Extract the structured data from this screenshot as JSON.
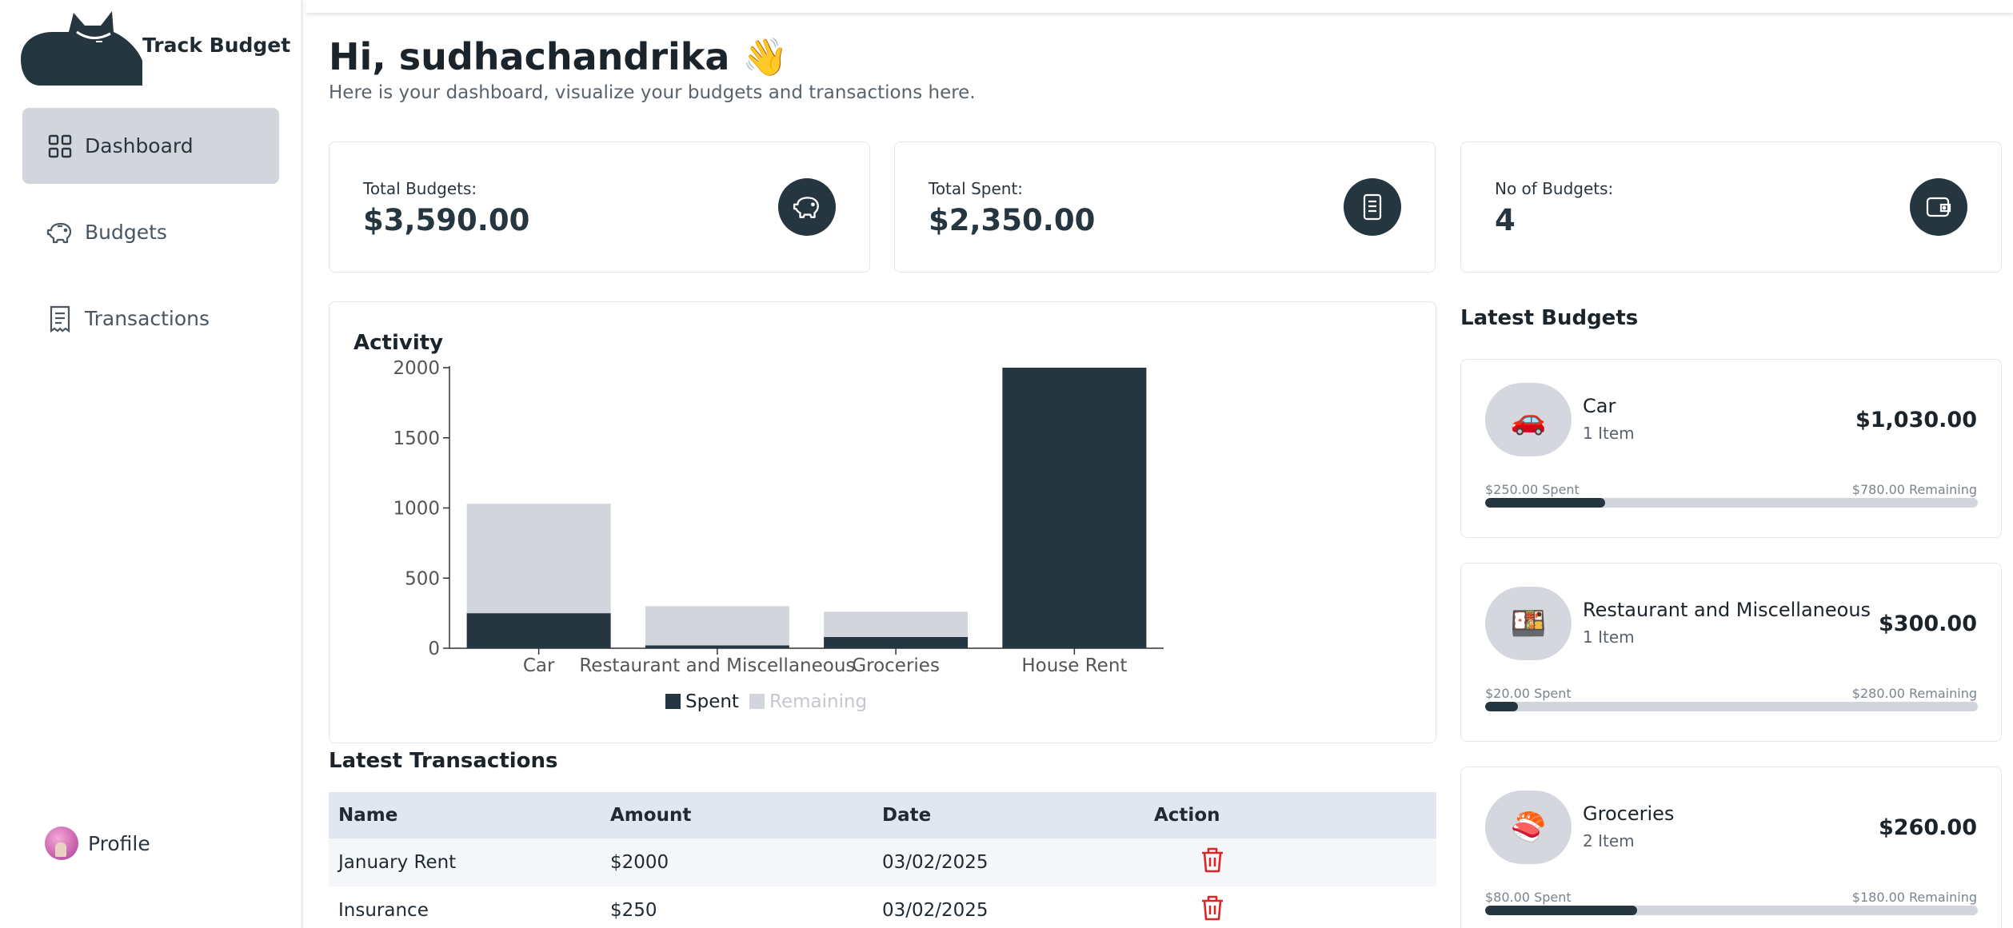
{
  "app": {
    "brand_name": "Track Budget"
  },
  "sidebar": {
    "items": [
      {
        "label": "Dashboard",
        "icon": "dashboard-grid-icon",
        "active": true
      },
      {
        "label": "Budgets",
        "icon": "piggy-bank-icon",
        "active": false
      },
      {
        "label": "Transactions",
        "icon": "receipt-icon",
        "active": false
      }
    ],
    "profile_label": "Profile"
  },
  "header": {
    "greeting": "Hi, sudhachandrika 👋",
    "subtitle": "Here is your dashboard, visualize your budgets and transactions here."
  },
  "stats": [
    {
      "label": "Total Budgets:",
      "value": "$3,590.00",
      "icon": "piggy-bank-icon"
    },
    {
      "label": "Total Spent:",
      "value": "$2,350.00",
      "icon": "receipt-icon"
    },
    {
      "label": "No of Budgets:",
      "value": "4",
      "icon": "wallet-icon"
    }
  ],
  "activity": {
    "title": "Activity"
  },
  "chart_data": {
    "type": "bar",
    "stacked": true,
    "title": "Activity",
    "categories": [
      "Car",
      "Restaurant and Miscellaneous",
      "Groceries",
      "House Rent"
    ],
    "series": [
      {
        "name": "Spent",
        "values": [
          250,
          20,
          80,
          2000
        ],
        "color": "#263640"
      },
      {
        "name": "Remaining",
        "values": [
          780,
          280,
          180,
          0
        ],
        "color": "#d2d5db"
      }
    ],
    "yticks": [
      0,
      500,
      1000,
      1500,
      2000
    ],
    "ylim": [
      0,
      2000
    ],
    "legend": "bottom",
    "grid": false
  },
  "transactions": {
    "title": "Latest Transactions",
    "columns": [
      "Name",
      "Amount",
      "Date",
      "Action"
    ],
    "rows": [
      {
        "name": "January Rent",
        "amount": "$2000",
        "date": "03/02/2025"
      },
      {
        "name": "Insurance",
        "amount": "$250",
        "date": "03/02/2025"
      }
    ]
  },
  "latest_budgets": {
    "title": "Latest Budgets",
    "items": [
      {
        "name": "Car",
        "items": "1 Item",
        "amount": "$1,030.00",
        "spent_label": "$250.00 Spent",
        "remaining_label": "$780.00 Remaining",
        "progress": 0.243,
        "icon": "🚗"
      },
      {
        "name": "Restaurant and Miscellaneous",
        "items": "1 Item",
        "amount": "$300.00",
        "spent_label": "$20.00 Spent",
        "remaining_label": "$280.00 Remaining",
        "progress": 0.067,
        "icon": "🍱"
      },
      {
        "name": "Groceries",
        "items": "2 Item",
        "amount": "$260.00",
        "spent_label": "$80.00 Spent",
        "remaining_label": "$180.00 Remaining",
        "progress": 0.308,
        "icon": "🍣"
      }
    ]
  }
}
